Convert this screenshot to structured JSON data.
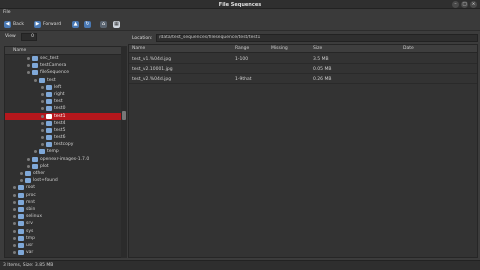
{
  "window": {
    "title": "File Sequences"
  },
  "menubar": {
    "file": "File"
  },
  "toolbar": {
    "back": "Back",
    "forward": "Forward"
  },
  "view": {
    "label": "View",
    "value": "0"
  },
  "location": {
    "label": "Location:",
    "value": "/data/test_sequences/filesequence/test/test1"
  },
  "tree": {
    "header": "Name",
    "items": [
      {
        "label": "sec_test",
        "indent": 3
      },
      {
        "label": "testCamera",
        "indent": 3
      },
      {
        "label": "fileSequence",
        "indent": 3
      },
      {
        "label": "test",
        "indent": 4
      },
      {
        "label": "left",
        "indent": 5
      },
      {
        "label": "right",
        "indent": 5
      },
      {
        "label": "test",
        "indent": 5
      },
      {
        "label": "test0",
        "indent": 5
      },
      {
        "label": "test1",
        "indent": 5,
        "selected": true
      },
      {
        "label": "test4",
        "indent": 5
      },
      {
        "label": "test5",
        "indent": 5
      },
      {
        "label": "test6",
        "indent": 5
      },
      {
        "label": "testcopy",
        "indent": 5
      },
      {
        "label": "temp",
        "indent": 4
      },
      {
        "label": "openexr-images-1.7.0",
        "indent": 3
      },
      {
        "label": "plot",
        "indent": 3
      },
      {
        "label": "other",
        "indent": 2
      },
      {
        "label": "lost+found",
        "indent": 2
      },
      {
        "label": "root",
        "indent": 1
      },
      {
        "label": "proc",
        "indent": 1
      },
      {
        "label": "mnt",
        "indent": 1
      },
      {
        "label": "sbin",
        "indent": 1
      },
      {
        "label": "selinux",
        "indent": 1
      },
      {
        "label": "srv",
        "indent": 1
      },
      {
        "label": "sys",
        "indent": 1
      },
      {
        "label": "tmp",
        "indent": 1
      },
      {
        "label": "usr",
        "indent": 1
      },
      {
        "label": "var",
        "indent": 1
      }
    ]
  },
  "files": {
    "headers": {
      "name": "Name",
      "range": "Range",
      "missing": "Missing",
      "size": "Size",
      "date": "Date"
    },
    "rows": [
      {
        "name": "test_v1.%04d.jpg",
        "range": "1-100",
        "missing": "",
        "size": "3.5 MB"
      },
      {
        "name": "test_v2.10001.jpg",
        "range": "",
        "missing": "",
        "size": "0.05 MB"
      },
      {
        "name": "test_v2.%04d.jpg",
        "range": "1-9that",
        "missing": "",
        "size": "0.26 MB"
      }
    ]
  },
  "status": {
    "text": "3 Items, Size: 3.85 MB"
  }
}
